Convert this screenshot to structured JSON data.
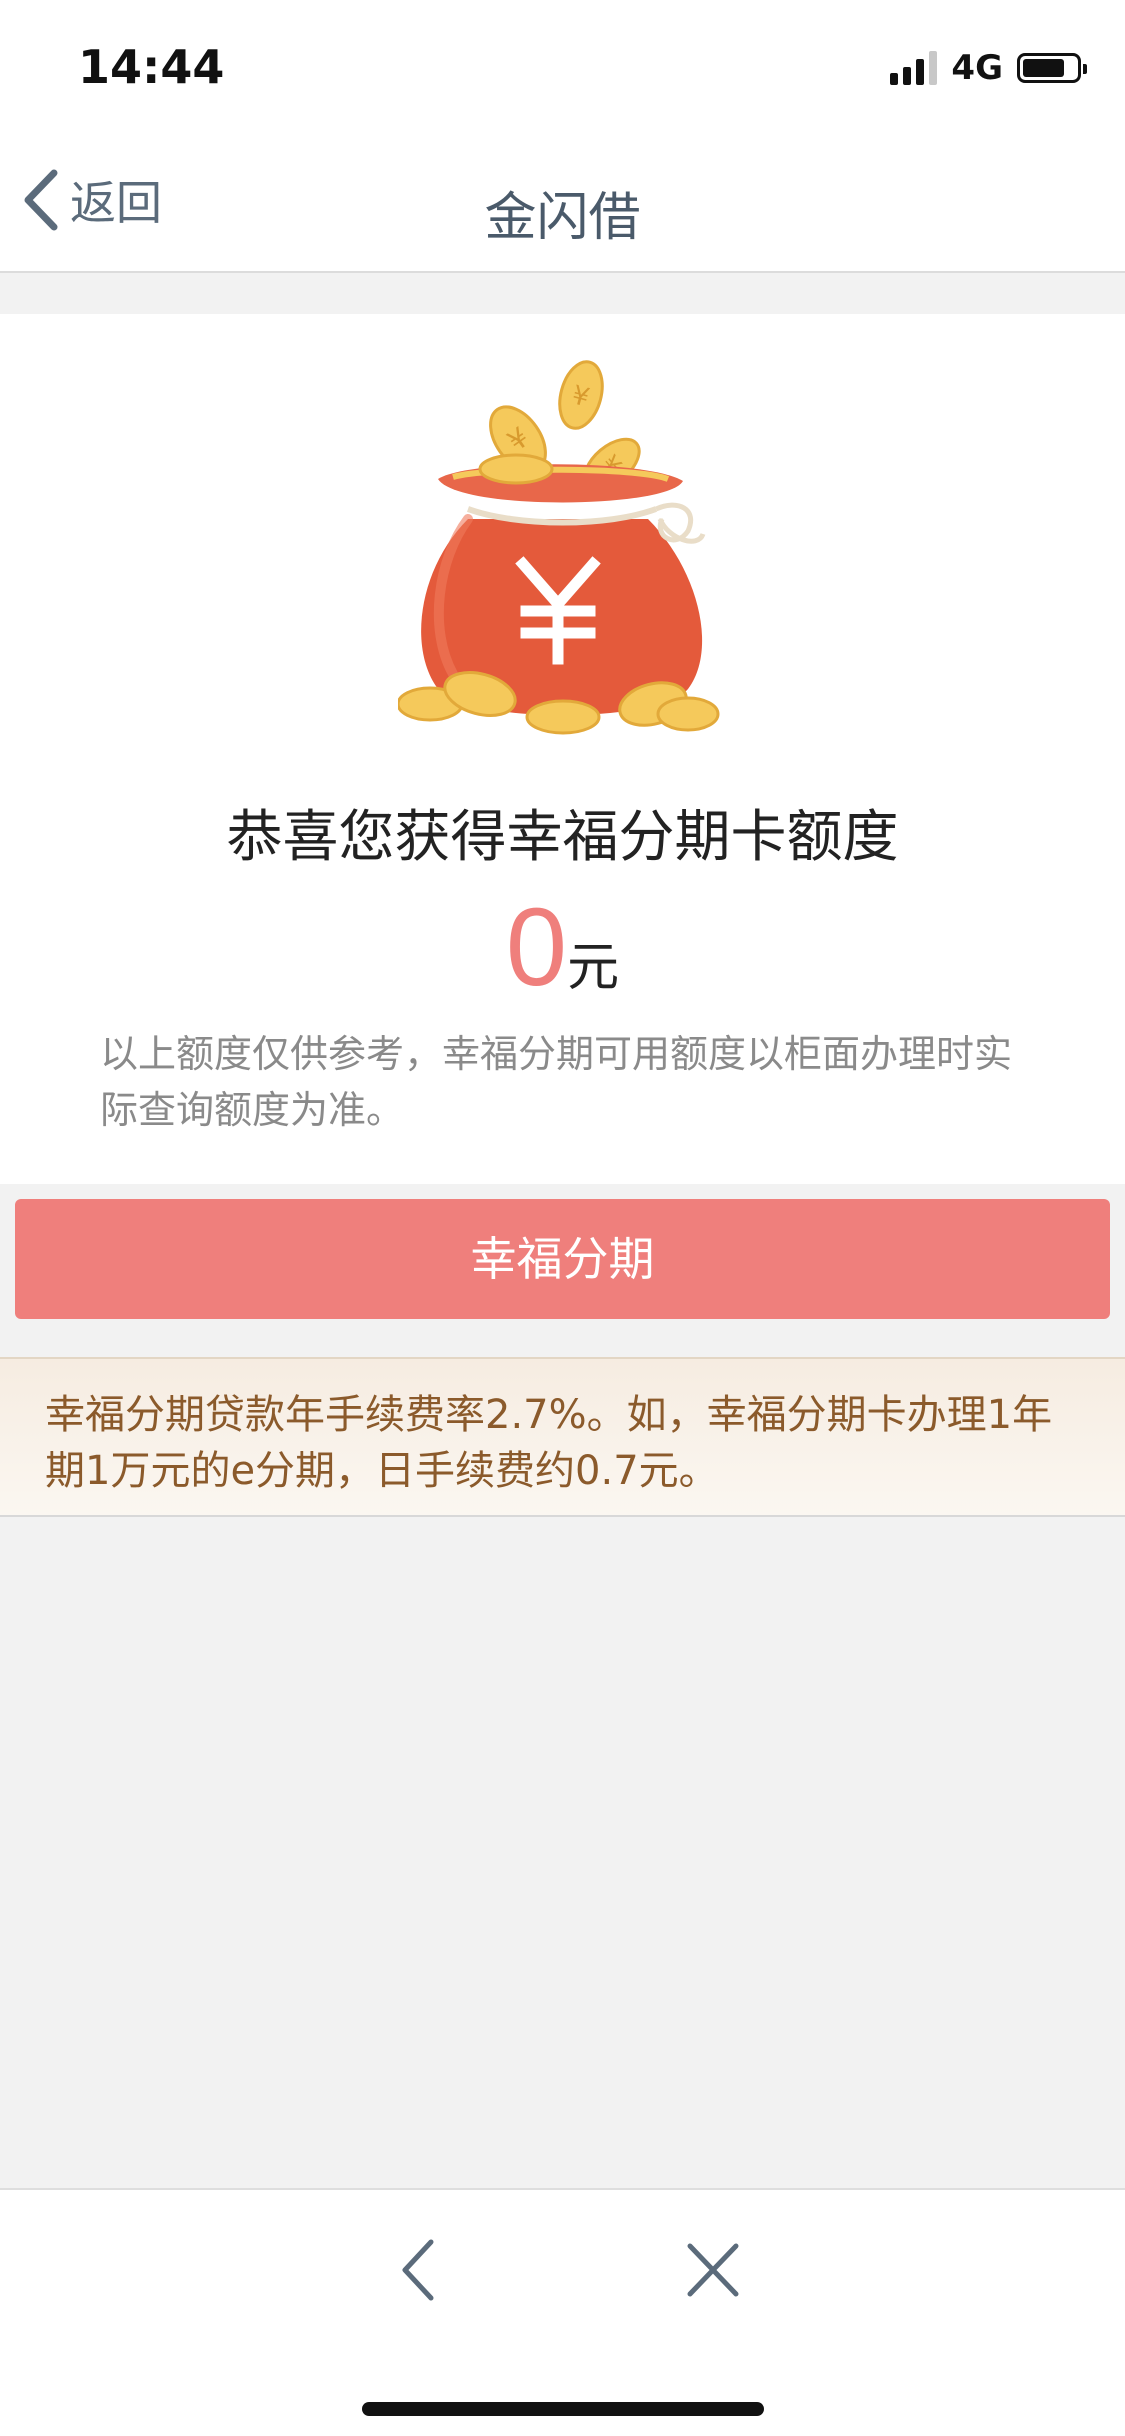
{
  "status_bar": {
    "time": "14:44",
    "network": "4G"
  },
  "nav": {
    "back_label": "返回",
    "title": "金闪借"
  },
  "card": {
    "headline": "恭喜您获得幸福分期卡额度",
    "amount": "0",
    "amount_unit": "元",
    "note": "以上额度仅供参考，幸福分期可用额度以柜面办理时实际查询额度为准。",
    "icon_glyph": "¥",
    "colors": {
      "bag": "#e45a3b",
      "coin": "#f5c95b",
      "amount": "#ef7f7c"
    }
  },
  "primary_button": {
    "label": "幸福分期",
    "color": "#ef7f7c"
  },
  "info": {
    "text": "幸福分期贷款年手续费率2.7%。如，幸福分期卡办理1年期1万元的e分期，日手续费约0.7元。",
    "color": "#8b5a2b"
  },
  "toolbar": {
    "back_icon": "chevron-left-icon",
    "close_icon": "close-icon"
  }
}
